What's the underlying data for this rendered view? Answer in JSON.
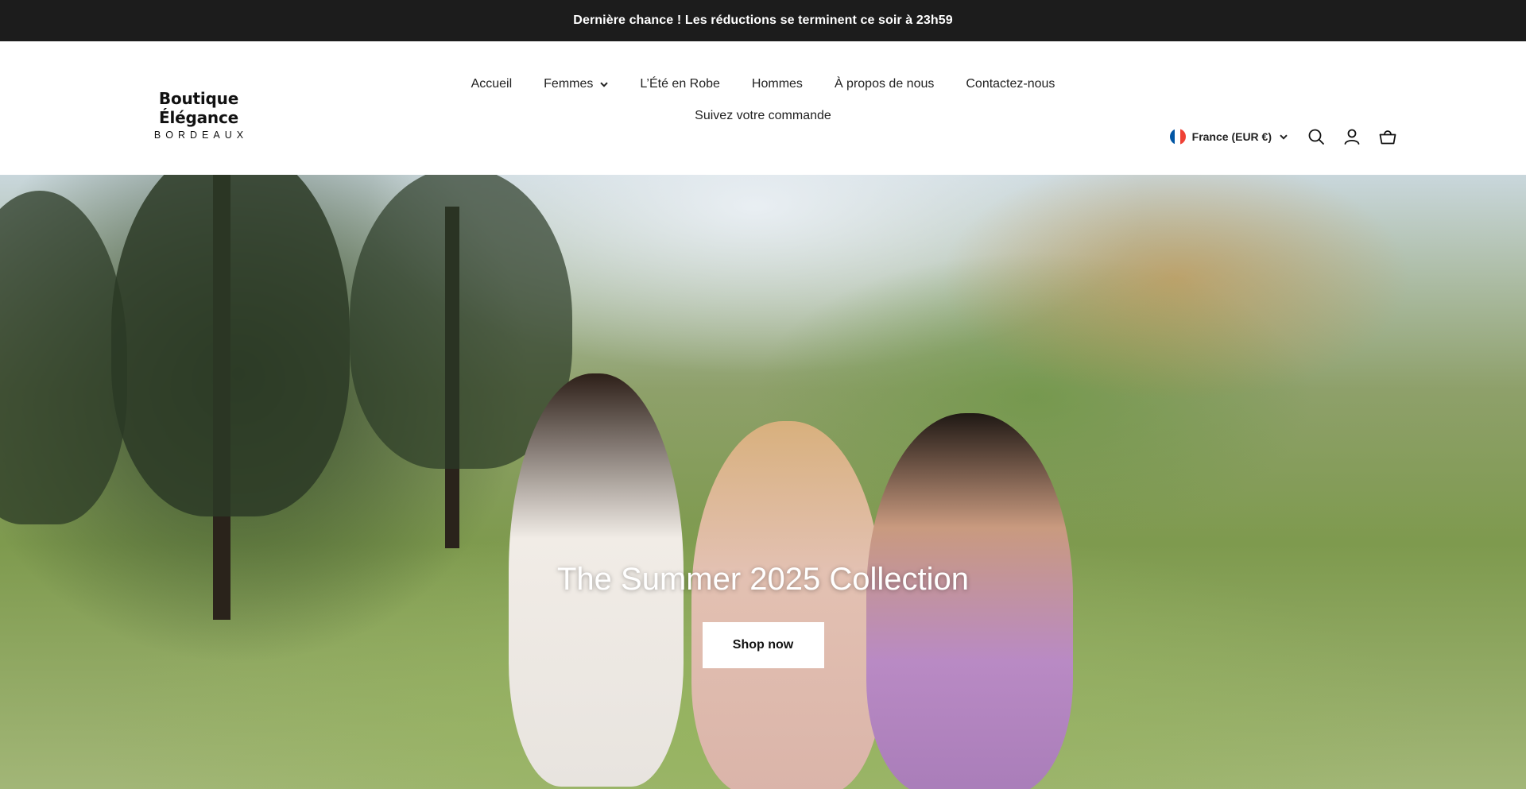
{
  "announcement": {
    "text": "Dernière chance ! Les réductions se terminent ce soir à 23h59"
  },
  "logo": {
    "name": "Boutique Élégance",
    "city": "BORDEAUX"
  },
  "nav": {
    "items": [
      {
        "label": "Accueil"
      },
      {
        "label": "Femmes",
        "has_dropdown": true
      },
      {
        "label": "L’Été en Robe"
      },
      {
        "label": "Hommes"
      },
      {
        "label": "À propos de nous"
      },
      {
        "label": "Contactez-nous"
      },
      {
        "label": "Suivez votre commande"
      }
    ]
  },
  "locale": {
    "label": "France (EUR €)",
    "flag_colors": [
      "#0055A4",
      "#FFFFFF",
      "#EF4135"
    ]
  },
  "icons": {
    "search": "search-icon",
    "account": "account-icon",
    "cart": "cart-icon"
  },
  "hero": {
    "title": "The Summer 2025 Collection",
    "button_label": "Shop now"
  },
  "colors": {
    "announcement_bg": "#1c1c1c",
    "text": "#1a1a1a",
    "button_bg": "#ffffff"
  }
}
